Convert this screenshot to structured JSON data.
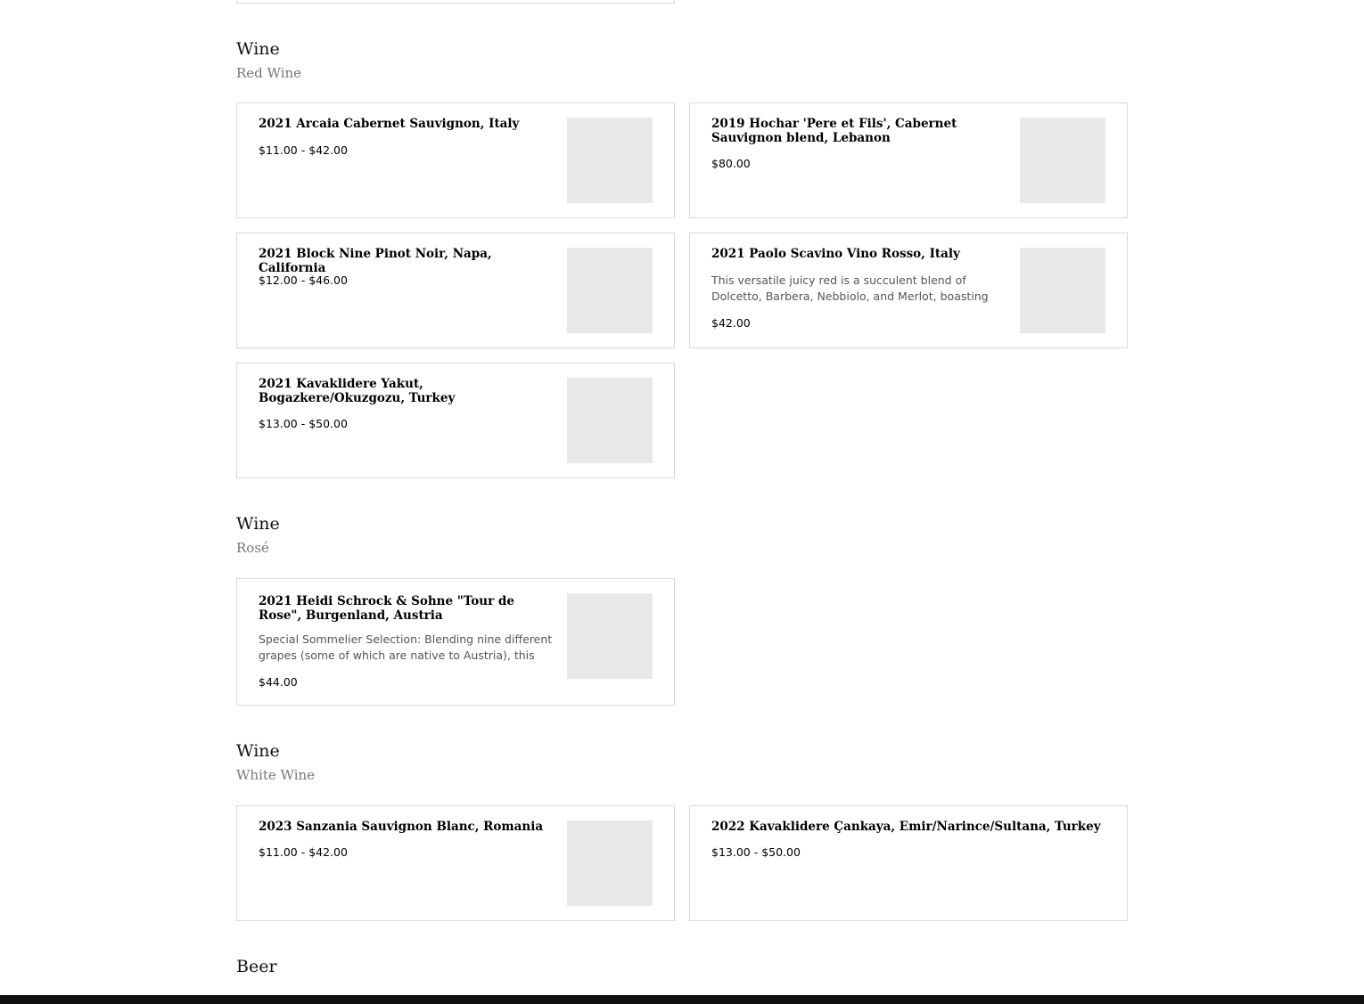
{
  "sections": {
    "red": {
      "title": "Wine",
      "subtitle": "Red Wine",
      "items": [
        {
          "name": "2021 Arcaia Cabernet Sauvignon, Italy",
          "price": "$11.00 - $42.00"
        },
        {
          "name": "2019 Hochar 'Pere et Fils', Cabernet Sauvignon blend, Lebanon",
          "price": "$80.00"
        },
        {
          "name": "2021 Block Nine Pinot Noir, Napa, California",
          "price": "$12.00 - $46.00"
        },
        {
          "name": "2021 Paolo Scavino Vino Rosso, Italy",
          "description": "This versatile juicy red is a succulent blend of Dolcetto, Barbera, Nebbiolo, and Merlot, boasting cherry, black…",
          "price": "$42.00"
        },
        {
          "name": "2021 Kavaklidere Yakut, Bogazkere/Okuzgozu, Turkey",
          "price": "$13.00 - $50.00"
        }
      ]
    },
    "rose": {
      "title": "Wine",
      "subtitle": "Rosé",
      "items": [
        {
          "name": "2021 Heidi Schrock & Sohne \"Tour de Rose\", Burgenland, Austria",
          "description": "Special Sommelier Selection: Blending nine different grapes (some of which are native to Austria), this rose…",
          "price": "$44.00"
        }
      ]
    },
    "white": {
      "title": "Wine",
      "subtitle": "White Wine",
      "items": [
        {
          "name": "2023 Sanzania Sauvignon Blanc, Romania",
          "price": "$11.00 - $42.00"
        },
        {
          "name": "2022 Kavaklidere Çankaya, Emir/Narince/Sultana, Turkey",
          "price": "$13.00 - $50.00"
        }
      ]
    },
    "beer": {
      "title": "Beer"
    }
  }
}
